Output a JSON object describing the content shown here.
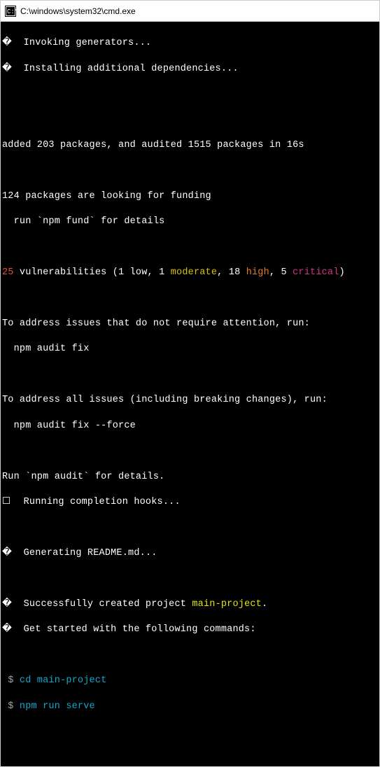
{
  "titlebar": {
    "path": "C:\\windows\\system32\\cmd.exe"
  },
  "lines": {
    "invoking": "Invoking generators...",
    "installing": "Installing additional dependencies...",
    "added": "added 203 packages, and audited 1515 packages in 16s",
    "funding1": "124 packages are looking for funding",
    "funding2": "  run `npm fund` for details",
    "vuln_count": "25",
    "vuln_rest1": " vulnerabilities (1 low, 1 ",
    "vuln_moderate": "moderate",
    "vuln_rest2": ", 18 ",
    "vuln_high": "high",
    "vuln_rest3": ", 5 ",
    "vuln_critical": "critical",
    "vuln_rest4": ")",
    "addr1a": "To address issues that do not require attention, run:",
    "addr1b": "  npm audit fix",
    "addr2a": "To address all issues (including breaking changes), run:",
    "addr2b": "  npm audit fix --force",
    "audit": "Run `npm audit` for details.",
    "hooks": "Running completion hooks...",
    "readme": "Generating README.md...",
    "success1": "Successfully created project ",
    "project": "main-project",
    "success2": ".",
    "getstarted": "Get started with the following commands:",
    "prompt": " $ ",
    "cmd1": "cd main-project",
    "cmd2": "npm run serve"
  }
}
